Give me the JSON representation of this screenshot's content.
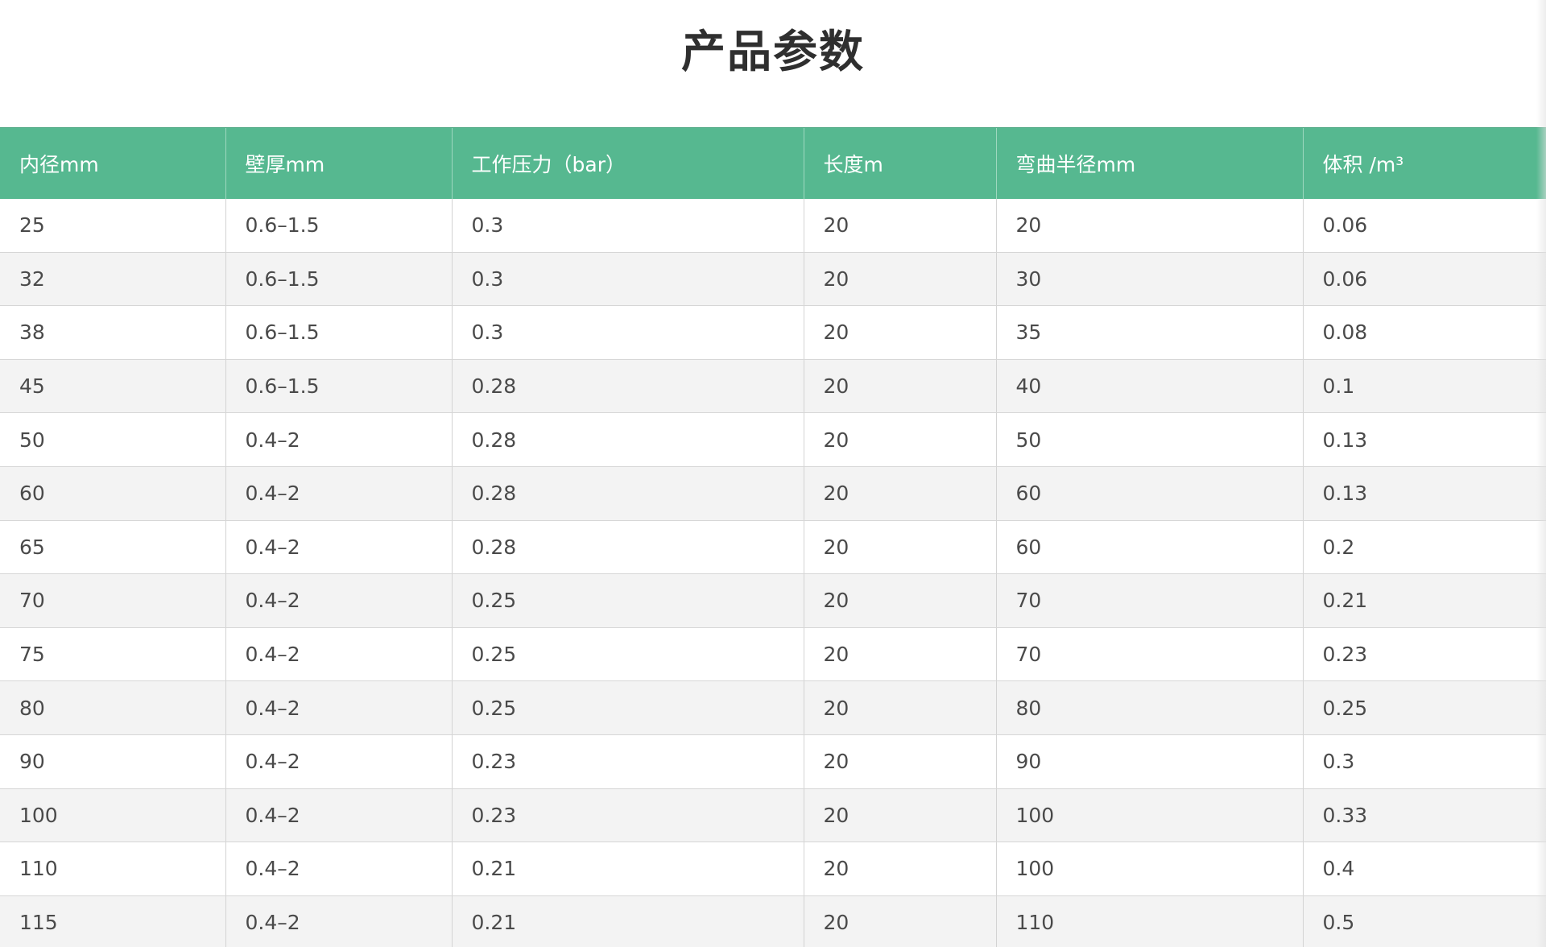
{
  "page": {
    "title": "产品参数"
  },
  "table": {
    "headers": [
      "内径mm",
      "壁厚mm",
      "工作压力（bar）",
      "长度m",
      "弯曲半径mm",
      "体积 /m³"
    ],
    "rows": [
      [
        "25",
        "0.6–1.5",
        "0.3",
        "20",
        "20",
        "0.06"
      ],
      [
        "32",
        "0.6–1.5",
        "0.3",
        "20",
        "30",
        "0.06"
      ],
      [
        "38",
        "0.6–1.5",
        "0.3",
        "20",
        "35",
        "0.08"
      ],
      [
        "45",
        "0.6–1.5",
        "0.28",
        "20",
        "40",
        "0.1"
      ],
      [
        "50",
        "0.4–2",
        "0.28",
        "20",
        "50",
        "0.13"
      ],
      [
        "60",
        "0.4–2",
        "0.28",
        "20",
        "60",
        "0.13"
      ],
      [
        "65",
        "0.4–2",
        "0.28",
        "20",
        "60",
        "0.2"
      ],
      [
        "70",
        "0.4–2",
        "0.25",
        "20",
        "70",
        "0.21"
      ],
      [
        "75",
        "0.4–2",
        "0.25",
        "20",
        "70",
        "0.23"
      ],
      [
        "80",
        "0.4–2",
        "0.25",
        "20",
        "80",
        "0.25"
      ],
      [
        "90",
        "0.4–2",
        "0.23",
        "20",
        "90",
        "0.3"
      ],
      [
        "100",
        "0.4–2",
        "0.23",
        "20",
        "100",
        "0.33"
      ],
      [
        "110",
        "0.4–2",
        "0.21",
        "20",
        "100",
        "0.4"
      ],
      [
        "115",
        "0.4–2",
        "0.21",
        "20",
        "110",
        "0.5"
      ]
    ]
  },
  "colors": {
    "header_bg": "#56b890",
    "header_text": "#ffffff",
    "row_alt_bg": "#f3f3f3",
    "title_text": "#2f2f2f"
  }
}
